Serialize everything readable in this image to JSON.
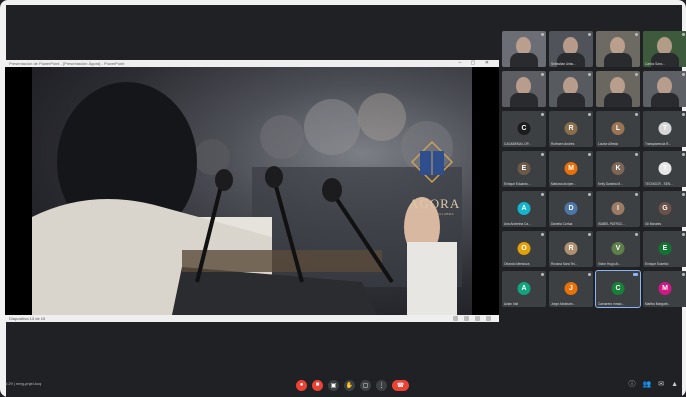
{
  "presentation": {
    "window_title": "Presentación de PowerPoint - [Presentación Ágora] - PowerPoint",
    "footer_text": "Diapositiva 13 de 15",
    "logo_text": "AGORA",
    "logo_subtitle": "ESCUELA DE LA PALABRA"
  },
  "participants": [
    {
      "name": "",
      "type": "video",
      "bg": "#6b6e75"
    },
    {
      "name": "Sebastian Arias...",
      "type": "video",
      "bg": "#50545a"
    },
    {
      "name": "",
      "type": "video",
      "bg": "#6d6a63"
    },
    {
      "name": "Carlos Sanc...",
      "type": "video",
      "bg": "#3e5a3c"
    },
    {
      "name": "",
      "type": "video",
      "bg": "#5c5e63"
    },
    {
      "name": "",
      "type": "video",
      "bg": "#575a5e"
    },
    {
      "name": "",
      "type": "video",
      "bg": "#6a6660"
    },
    {
      "name": "",
      "type": "video",
      "bg": "#5d6064"
    },
    {
      "name": "CASABEMA LOP...",
      "type": "avatar",
      "initial": "C",
      "color": "#1c1c1c"
    },
    {
      "name": "Ruthwen Andrés",
      "type": "avatar",
      "initial": "R",
      "color": "#8a6d4b"
    },
    {
      "name": "Louise Alfredo",
      "type": "avatar",
      "initial": "L",
      "color": "#9a7555"
    },
    {
      "name": "Transparencia R...",
      "type": "avatar",
      "initial": "T",
      "color": "#d6d6d6"
    },
    {
      "name": "Enrique Eduardo...",
      "type": "avatar",
      "initial": "E",
      "color": "#6b5a4a"
    },
    {
      "name": "Mariana Arciper...",
      "type": "avatar",
      "initial": "M",
      "color": "#e8710a"
    },
    {
      "name": "Kelly Daniela M...",
      "type": "avatar",
      "initial": "K",
      "color": "#7d6656"
    },
    {
      "name": "TECNOCR - SEN...",
      "type": "avatar",
      "initial": "T",
      "color": "#e6e6e6"
    },
    {
      "name": "Ana Andreina Ca...",
      "type": "avatar",
      "initial": "A",
      "color": "#12b5cb"
    },
    {
      "name": "Daniela Cortua",
      "type": "avatar",
      "initial": "D",
      "color": "#4c76a8"
    },
    {
      "name": "ISABEL PATRICI...",
      "type": "avatar",
      "initial": "I",
      "color": "#9c7b66"
    },
    {
      "name": "Gil Morales",
      "type": "avatar",
      "initial": "G",
      "color": "#6b5248"
    },
    {
      "name": "Orlando Mendoza",
      "type": "avatar",
      "initial": "O",
      "color": "#e3a008"
    },
    {
      "name": "Roxana Sara Tel...",
      "type": "avatar",
      "initial": "R",
      "color": "#b09070"
    },
    {
      "name": "Victor Hugo Ar...",
      "type": "avatar",
      "initial": "V",
      "color": "#5f7f4a"
    },
    {
      "name": "Enrique Eusebio",
      "type": "avatar",
      "initial": "E",
      "color": "#137333"
    },
    {
      "name": "Azian Irali",
      "type": "avatar",
      "initial": "A",
      "color": "#12a37f"
    },
    {
      "name": "Jorge Abraham...",
      "type": "avatar",
      "initial": "J",
      "color": "#e8710a"
    },
    {
      "name": "Camarero mmac...",
      "type": "avatar",
      "initial": "C",
      "color": "#188038",
      "active": true
    },
    {
      "name": "Martha Margarit...",
      "type": "avatar",
      "initial": "M",
      "color": "#d01884"
    }
  ],
  "meeting": {
    "time_and_code": "5:29 | meg-pnjei-kcq"
  },
  "controls": [
    {
      "name": "mic-off-button",
      "glyph": "●",
      "red": true
    },
    {
      "name": "camera-off-button",
      "glyph": "■",
      "red": true
    },
    {
      "name": "captions-button",
      "glyph": "▣",
      "red": false
    },
    {
      "name": "raise-hand-button",
      "glyph": "✋",
      "red": false
    },
    {
      "name": "present-button",
      "glyph": "▢",
      "red": false
    },
    {
      "name": "more-options-button",
      "glyph": "⋮",
      "red": false
    },
    {
      "name": "leave-call-button",
      "glyph": "☎",
      "red": true,
      "pill": true
    }
  ],
  "right_controls": [
    {
      "name": "info-icon",
      "glyph": "ⓘ"
    },
    {
      "name": "people-icon",
      "glyph": "👥"
    },
    {
      "name": "chat-icon",
      "glyph": "✉"
    },
    {
      "name": "activities-icon",
      "glyph": "▲"
    }
  ],
  "colors": {
    "background": "#202124",
    "tile": "#3c4043",
    "danger": "#ea4335",
    "accent": "#8ab4f8"
  }
}
